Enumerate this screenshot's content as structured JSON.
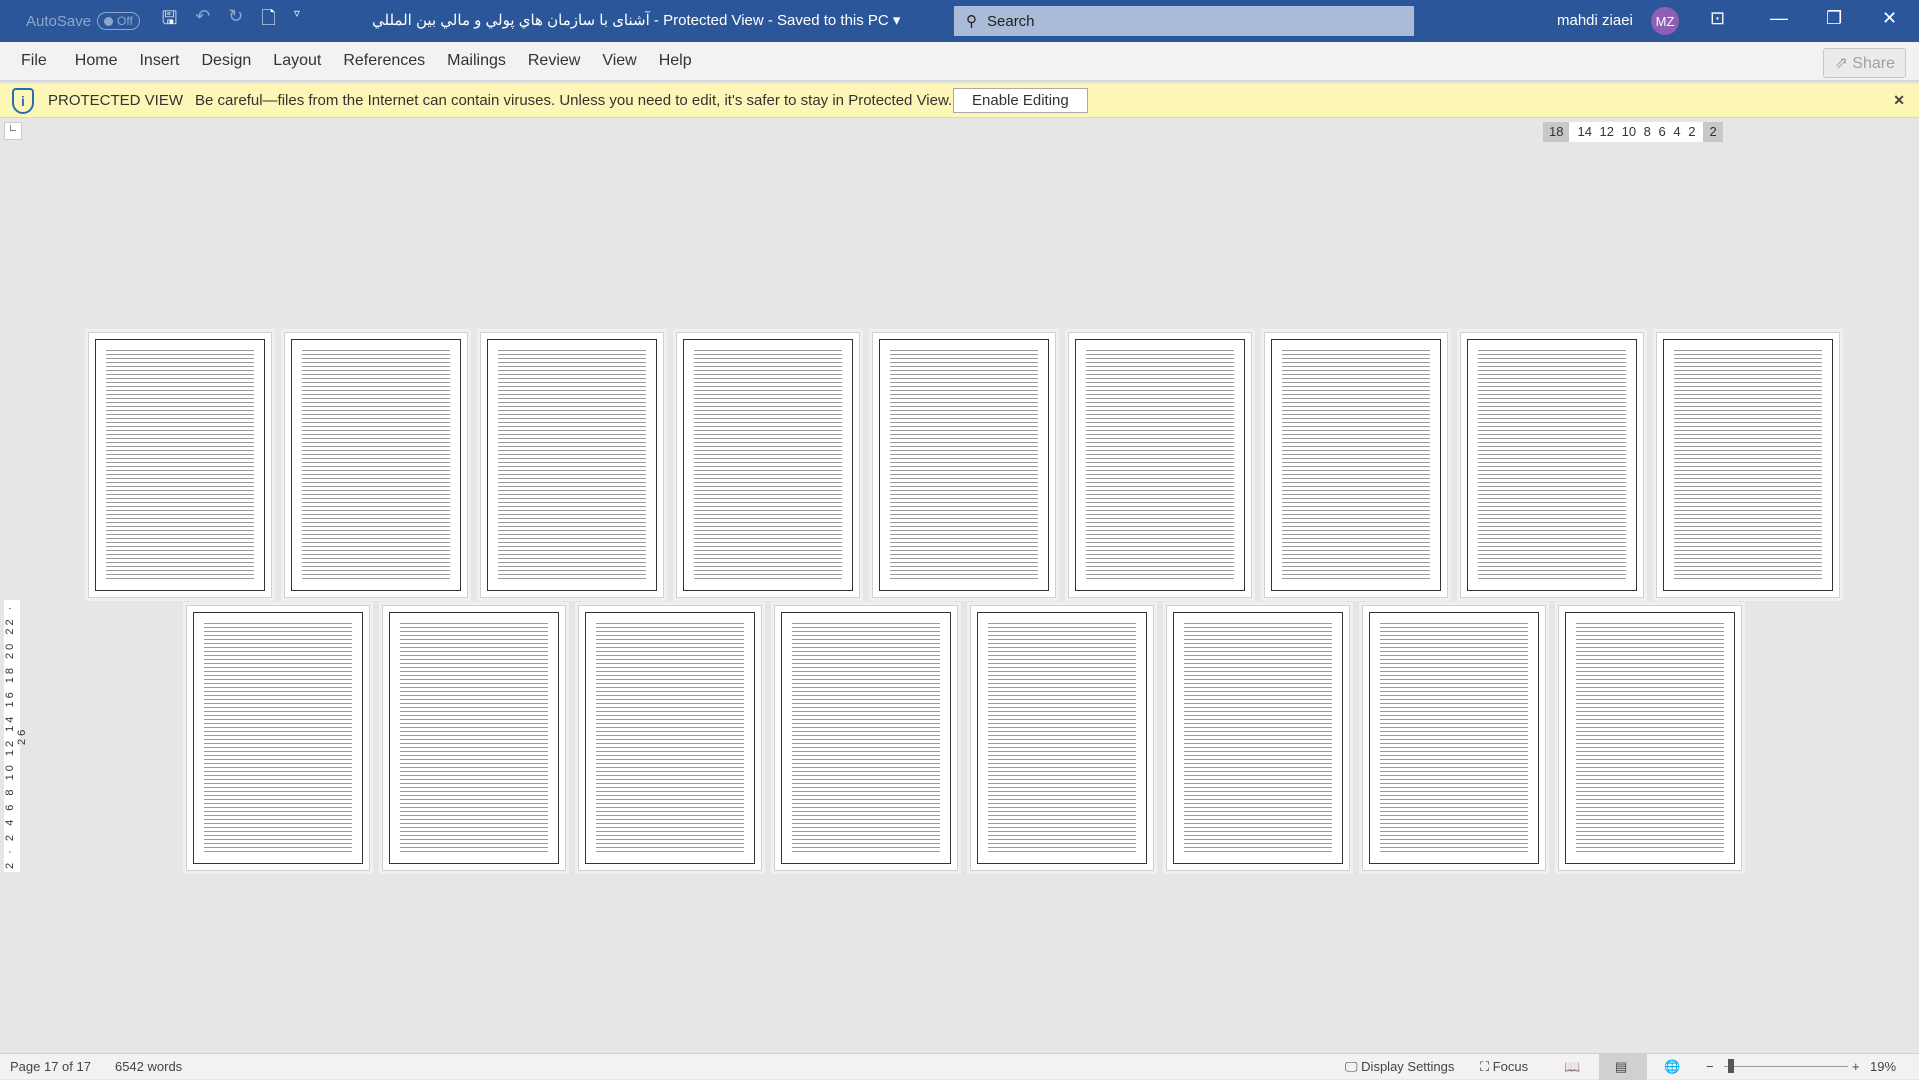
{
  "titlebar": {
    "autosave": "AutoSave",
    "autosave_state": "Off",
    "title": "آشنای با سازمان هاي پولي و مالي بين المللي  -  Protected View  -  Saved to this PC",
    "search_placeholder": "Search",
    "user": "mahdi ziaei",
    "initials": "MZ"
  },
  "ribbon": {
    "tabs": [
      "File",
      "Home",
      "Insert",
      "Design",
      "Layout",
      "References",
      "Mailings",
      "Review",
      "View",
      "Help"
    ],
    "share": "Share"
  },
  "protected_view": {
    "label": "PROTECTED VIEW",
    "message": "Be careful—files from the Internet can contain viruses. Unless you need to edit, it's safer to stay in Protected View.",
    "button": "Enable Editing"
  },
  "ruler": {
    "left": "18",
    "middle": "14 12 10 8 6 4 2",
    "right": "2",
    "vertical": "2 · 2 4 6 8 10 12 14 16 18 20 22 · 26"
  },
  "document": {
    "row1_pages": 9,
    "row2_pages": 8
  },
  "status": {
    "page": "Page 17 of 17",
    "words": "6542 words",
    "display_settings": "Display Settings",
    "focus": "Focus",
    "zoom": "19%"
  }
}
